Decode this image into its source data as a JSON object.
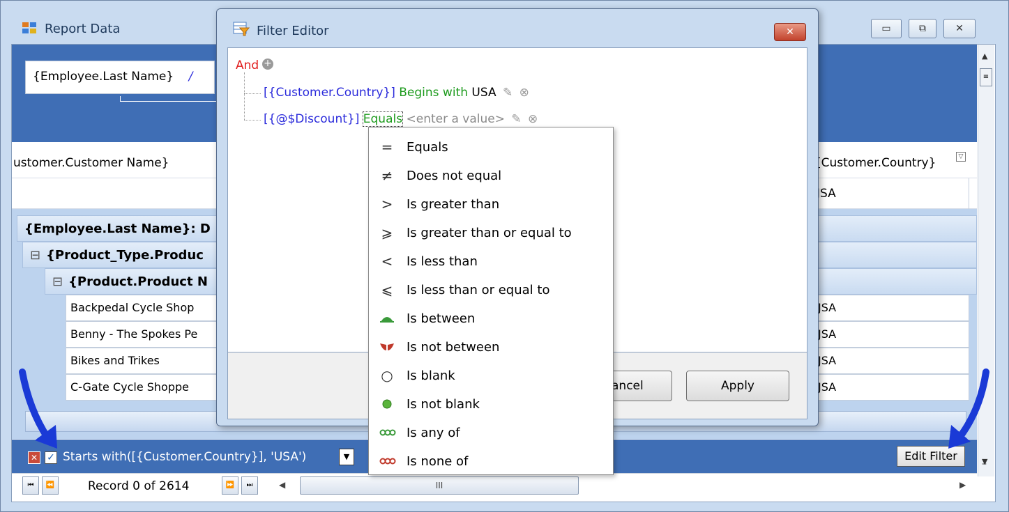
{
  "window": {
    "title": "Report Data",
    "buttons": [
      "▭",
      "⧉",
      "✕"
    ]
  },
  "report": {
    "employee_field": "{Employee.Last Name}",
    "employee_cursor": "/",
    "col_customer_name": "ustomer.Customer Name}",
    "col_customer_country": "[Customer.Country}",
    "first_row_country": "JSA",
    "group_employee": "{Employee.Last Name}: D",
    "group_product_type": "{Product_Type.Produc",
    "group_product": "{Product.Product N",
    "rows": [
      {
        "name": "Backpedal Cycle Shop",
        "country": "JSA"
      },
      {
        "name": "Benny - The Spokes Pe",
        "country": "JSA"
      },
      {
        "name": "Bikes and Trikes",
        "country": "JSA"
      },
      {
        "name": "C-Gate Cycle Shoppe",
        "country": "JSA"
      }
    ]
  },
  "filter_bar": {
    "text": "Starts with([{Customer.Country}], 'USA')",
    "edit_button": "Edit Filter",
    "checked": true
  },
  "navigator": {
    "record_text": "Record 0 of 2614",
    "scroll_marker": "III"
  },
  "dialog": {
    "title": "Filter Editor",
    "close": "✕",
    "root_op": "And",
    "conditions": [
      {
        "field": "[{Customer.Country}]",
        "op": "Begins with",
        "value": "USA"
      },
      {
        "field": "[{@$Discount}]",
        "op": "Equals",
        "value": "<enter a value>"
      }
    ],
    "cancel_label": "ancel",
    "apply_label": "Apply"
  },
  "operator_menu": {
    "items": [
      {
        "icon": "equals-icon",
        "glyph": "=",
        "label": "Equals"
      },
      {
        "icon": "not-equal-icon",
        "glyph": "≠",
        "label": "Does not equal"
      },
      {
        "icon": "greater-than-icon",
        "glyph": ">",
        "label": "Is greater than"
      },
      {
        "icon": "greater-equal-icon",
        "glyph": "⩾",
        "label": "Is greater than or equal to"
      },
      {
        "icon": "less-than-icon",
        "glyph": "<",
        "label": "Is less than"
      },
      {
        "icon": "less-equal-icon",
        "glyph": "⩽",
        "label": "Is less than or equal to"
      },
      {
        "icon": "between-icon",
        "glyph": "",
        "label": "Is between"
      },
      {
        "icon": "not-between-icon",
        "glyph": "",
        "label": "Is not between"
      },
      {
        "icon": "blank-icon",
        "glyph": "○",
        "label": "Is blank"
      },
      {
        "icon": "not-blank-icon",
        "glyph": "",
        "label": "Is not blank"
      },
      {
        "icon": "any-of-icon",
        "glyph": "",
        "label": "Is any of"
      },
      {
        "icon": "none-of-icon",
        "glyph": "",
        "label": "Is none of"
      }
    ]
  },
  "colors": {
    "header_blue": "#3f6eb5",
    "arrow_blue": "#1a3ad6",
    "and_red": "#e01c1c",
    "field_blue": "#2b2bdb",
    "op_green": "#1c9a1c"
  }
}
